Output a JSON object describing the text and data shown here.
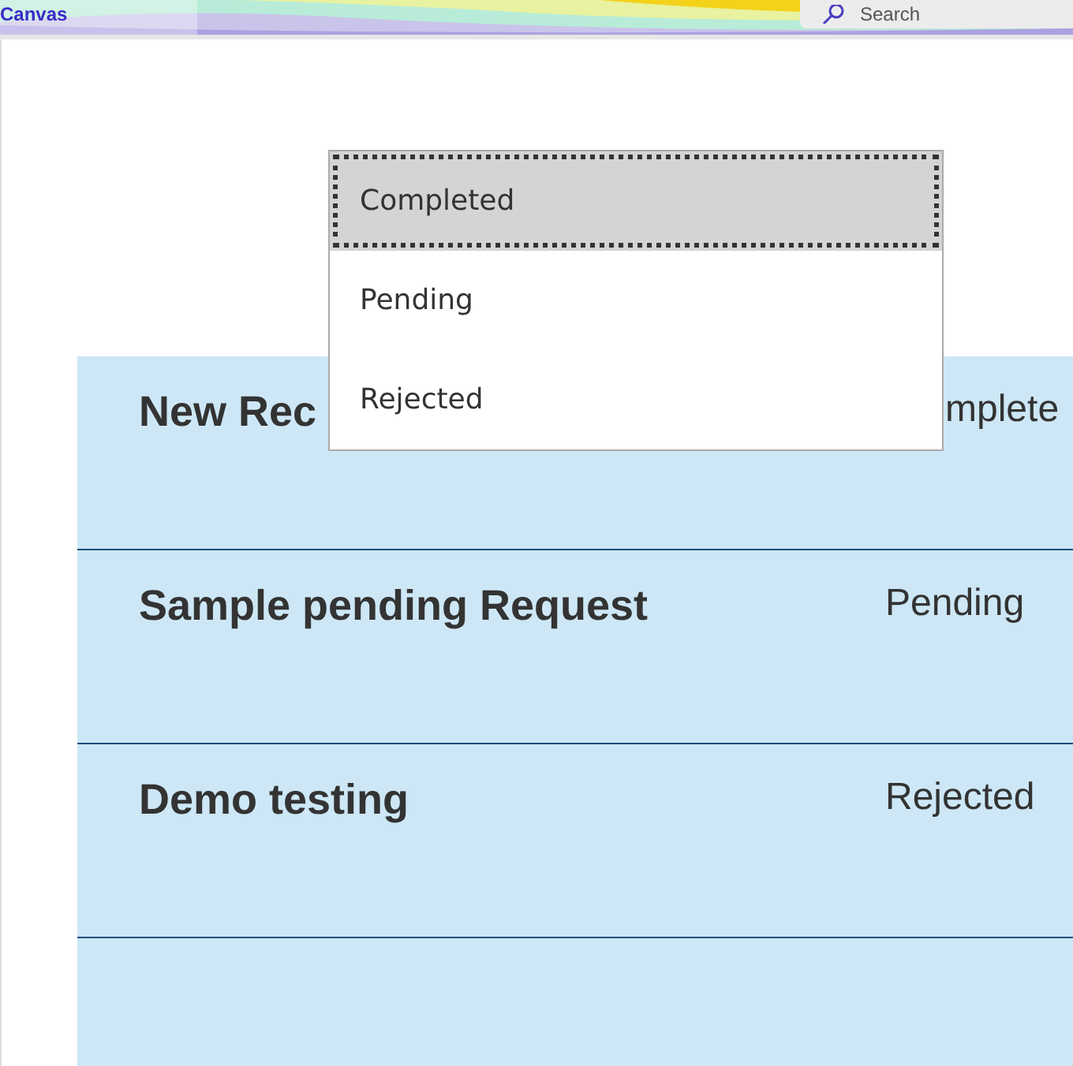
{
  "header": {
    "app_name": "Canvas",
    "search": {
      "placeholder": "Search"
    }
  },
  "requests": [
    {
      "title": "New Rec",
      "status": "mplete"
    },
    {
      "title": "Sample pending Request",
      "status": "Pending"
    },
    {
      "title": "Demo testing",
      "status": "Rejected"
    }
  ],
  "status_dropdown": {
    "options": [
      {
        "label": "Completed",
        "selected": true
      },
      {
        "label": "Pending",
        "selected": false
      },
      {
        "label": "Rejected",
        "selected": false
      }
    ]
  }
}
